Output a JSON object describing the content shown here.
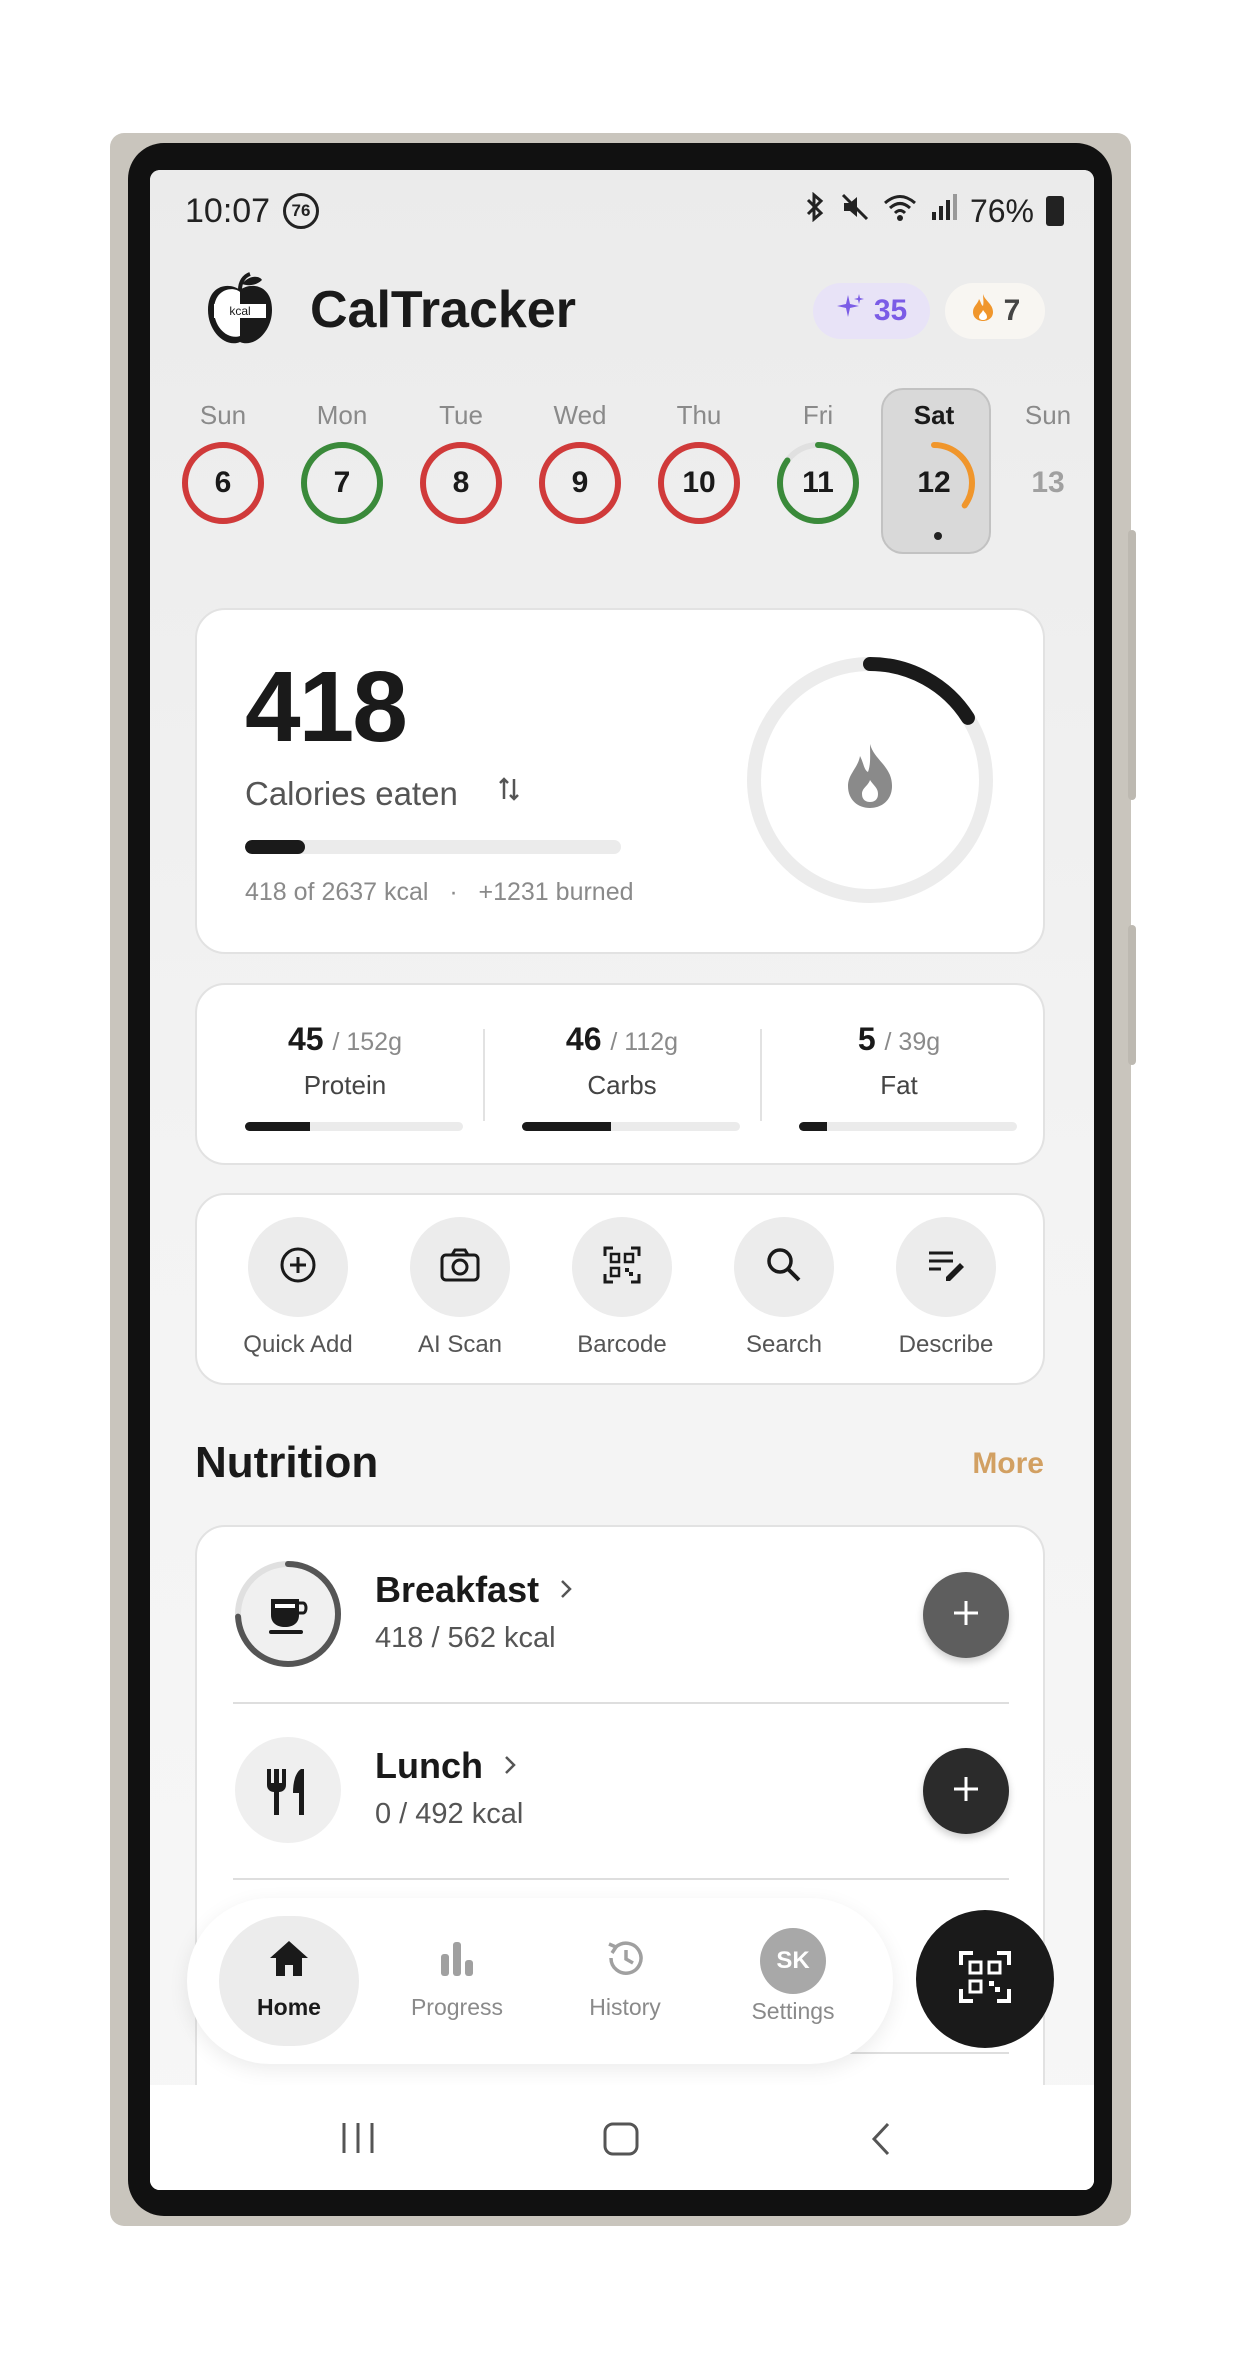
{
  "status_bar": {
    "time": "10:07",
    "notification_badge": "76",
    "battery": "76%"
  },
  "header": {
    "app_title": "CalTracker",
    "logo_text": "kcal",
    "sparkle_count": "35",
    "streak_count": "7",
    "accent_purple": "#7b5ce6",
    "accent_orange": "#f0962c"
  },
  "week": [
    {
      "day": "Sun",
      "date": "6",
      "status": "over",
      "progress": 1.0
    },
    {
      "day": "Mon",
      "date": "7",
      "status": "good",
      "progress": 1.0
    },
    {
      "day": "Tue",
      "date": "8",
      "status": "over",
      "progress": 1.0
    },
    {
      "day": "Wed",
      "date": "9",
      "status": "over",
      "progress": 1.0
    },
    {
      "day": "Thu",
      "date": "10",
      "status": "over",
      "progress": 1.0
    },
    {
      "day": "Fri",
      "date": "11",
      "status": "good",
      "progress": 0.85
    },
    {
      "day": "Sat",
      "date": "12",
      "status": "today",
      "progress": 0.35,
      "selected": true
    },
    {
      "day": "Sun",
      "date": "13",
      "status": "future",
      "progress": 0
    }
  ],
  "status_colors": {
    "over": "#d03a3a",
    "good": "#3a8a3a",
    "today": "#f0962c"
  },
  "calories": {
    "eaten": "418",
    "label": "Calories eaten",
    "summary": "418 of 2637 kcal",
    "burned": "+1231 burned",
    "progress": 0.16,
    "ring_progress": 0.16
  },
  "macros": [
    {
      "value": "45",
      "goal": "/ 152g",
      "name": "Protein",
      "progress": 0.3
    },
    {
      "value": "46",
      "goal": "/ 112g",
      "name": "Carbs",
      "progress": 0.41
    },
    {
      "value": "5",
      "goal": "/ 39g",
      "name": "Fat",
      "progress": 0.13
    }
  ],
  "quick_actions": [
    {
      "label": "Quick Add",
      "icon": "plus-circle-icon"
    },
    {
      "label": "AI Scan",
      "icon": "camera-icon"
    },
    {
      "label": "Barcode",
      "icon": "qr-code-icon"
    },
    {
      "label": "Search",
      "icon": "search-icon"
    },
    {
      "label": "Describe",
      "icon": "describe-icon"
    }
  ],
  "nutrition": {
    "title": "Nutrition",
    "more": "More",
    "meals": [
      {
        "name": "Breakfast",
        "kcal": "418 / 562 kcal",
        "icon": "coffee-cup-icon",
        "progress": 0.74
      },
      {
        "name": "Lunch",
        "kcal": "0 / 492 kcal",
        "icon": "fork-knife-icon",
        "progress": 0
      }
    ]
  },
  "bottom_nav": [
    {
      "label": "Home",
      "icon": "home-icon",
      "active": true
    },
    {
      "label": "Progress",
      "icon": "bar-chart-icon"
    },
    {
      "label": "History",
      "icon": "history-icon"
    },
    {
      "label": "Settings",
      "icon": "avatar",
      "initials": "SK"
    }
  ]
}
